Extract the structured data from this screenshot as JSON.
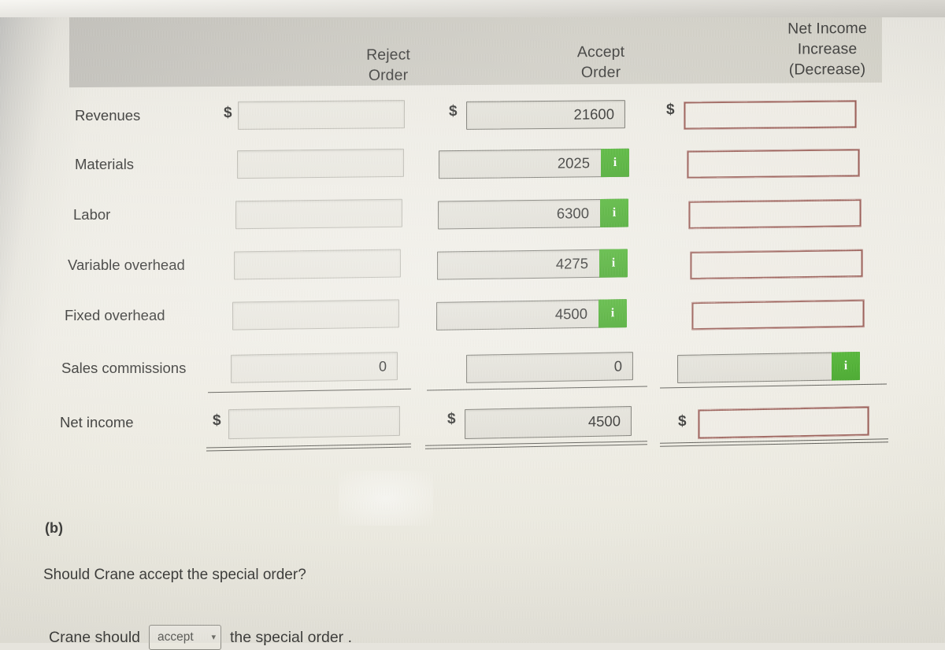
{
  "table": {
    "column_headers": [
      {
        "id": "label",
        "lines": []
      },
      {
        "id": "reject",
        "lines": [
          "Reject",
          "Order"
        ]
      },
      {
        "id": "accept",
        "lines": [
          "Accept",
          "Order"
        ]
      },
      {
        "id": "net",
        "lines": [
          "Net Income",
          "Increase",
          "(Decrease)"
        ]
      }
    ],
    "header_reject_l1": "Reject",
    "header_reject_l2": "Order",
    "header_accept_l1": "Accept",
    "header_accept_l2": "Order",
    "header_net_l1": "Net Income",
    "header_net_l2": "Increase",
    "header_net_l3": "(Decrease)",
    "currency_symbol": "$",
    "info_icon": "i",
    "rows": [
      {
        "label": "Revenues",
        "reject": {
          "value": "",
          "dollar": true,
          "info": false
        },
        "accept": {
          "value": "21600",
          "dollar": true,
          "info": false
        },
        "net": {
          "value": "",
          "dollar": true,
          "info": false
        }
      },
      {
        "label": "Materials",
        "reject": {
          "value": "",
          "dollar": false,
          "info": false
        },
        "accept": {
          "value": "2025",
          "dollar": false,
          "info": true
        },
        "net": {
          "value": "",
          "dollar": false,
          "info": false
        }
      },
      {
        "label": "Labor",
        "reject": {
          "value": "",
          "dollar": false,
          "info": false
        },
        "accept": {
          "value": "6300",
          "dollar": false,
          "info": true
        },
        "net": {
          "value": "",
          "dollar": false,
          "info": false
        }
      },
      {
        "label": "Variable overhead",
        "reject": {
          "value": "",
          "dollar": false,
          "info": false
        },
        "accept": {
          "value": "4275",
          "dollar": false,
          "info": true
        },
        "net": {
          "value": "",
          "dollar": false,
          "info": false
        }
      },
      {
        "label": "Fixed overhead",
        "reject": {
          "value": "",
          "dollar": false,
          "info": false
        },
        "accept": {
          "value": "4500",
          "dollar": false,
          "info": true
        },
        "net": {
          "value": "",
          "dollar": false,
          "info": false
        }
      },
      {
        "label": "Sales commissions",
        "reject": {
          "value": "0",
          "dollar": false,
          "info": false
        },
        "accept": {
          "value": "0",
          "dollar": false,
          "info": false
        },
        "net": {
          "value": "",
          "dollar": false,
          "info": true
        }
      },
      {
        "label": "Net income",
        "reject": {
          "value": "",
          "dollar": true,
          "info": false
        },
        "accept": {
          "value": "4500",
          "dollar": true,
          "info": false
        },
        "net": {
          "value": "",
          "dollar": true,
          "info": false
        }
      }
    ]
  },
  "part_b": {
    "label": "(b)",
    "question": "Should Crane accept the special order?",
    "answer_prefix": "Crane should",
    "answer_selected": "accept",
    "answer_suffix": "the special order .",
    "chevron": "⌄"
  },
  "colors": {
    "header_band": "#c7c5bd",
    "info_green": "#33a015",
    "red_border": "#8e4a42",
    "rule": "#4d4c46",
    "text": "#242422"
  }
}
